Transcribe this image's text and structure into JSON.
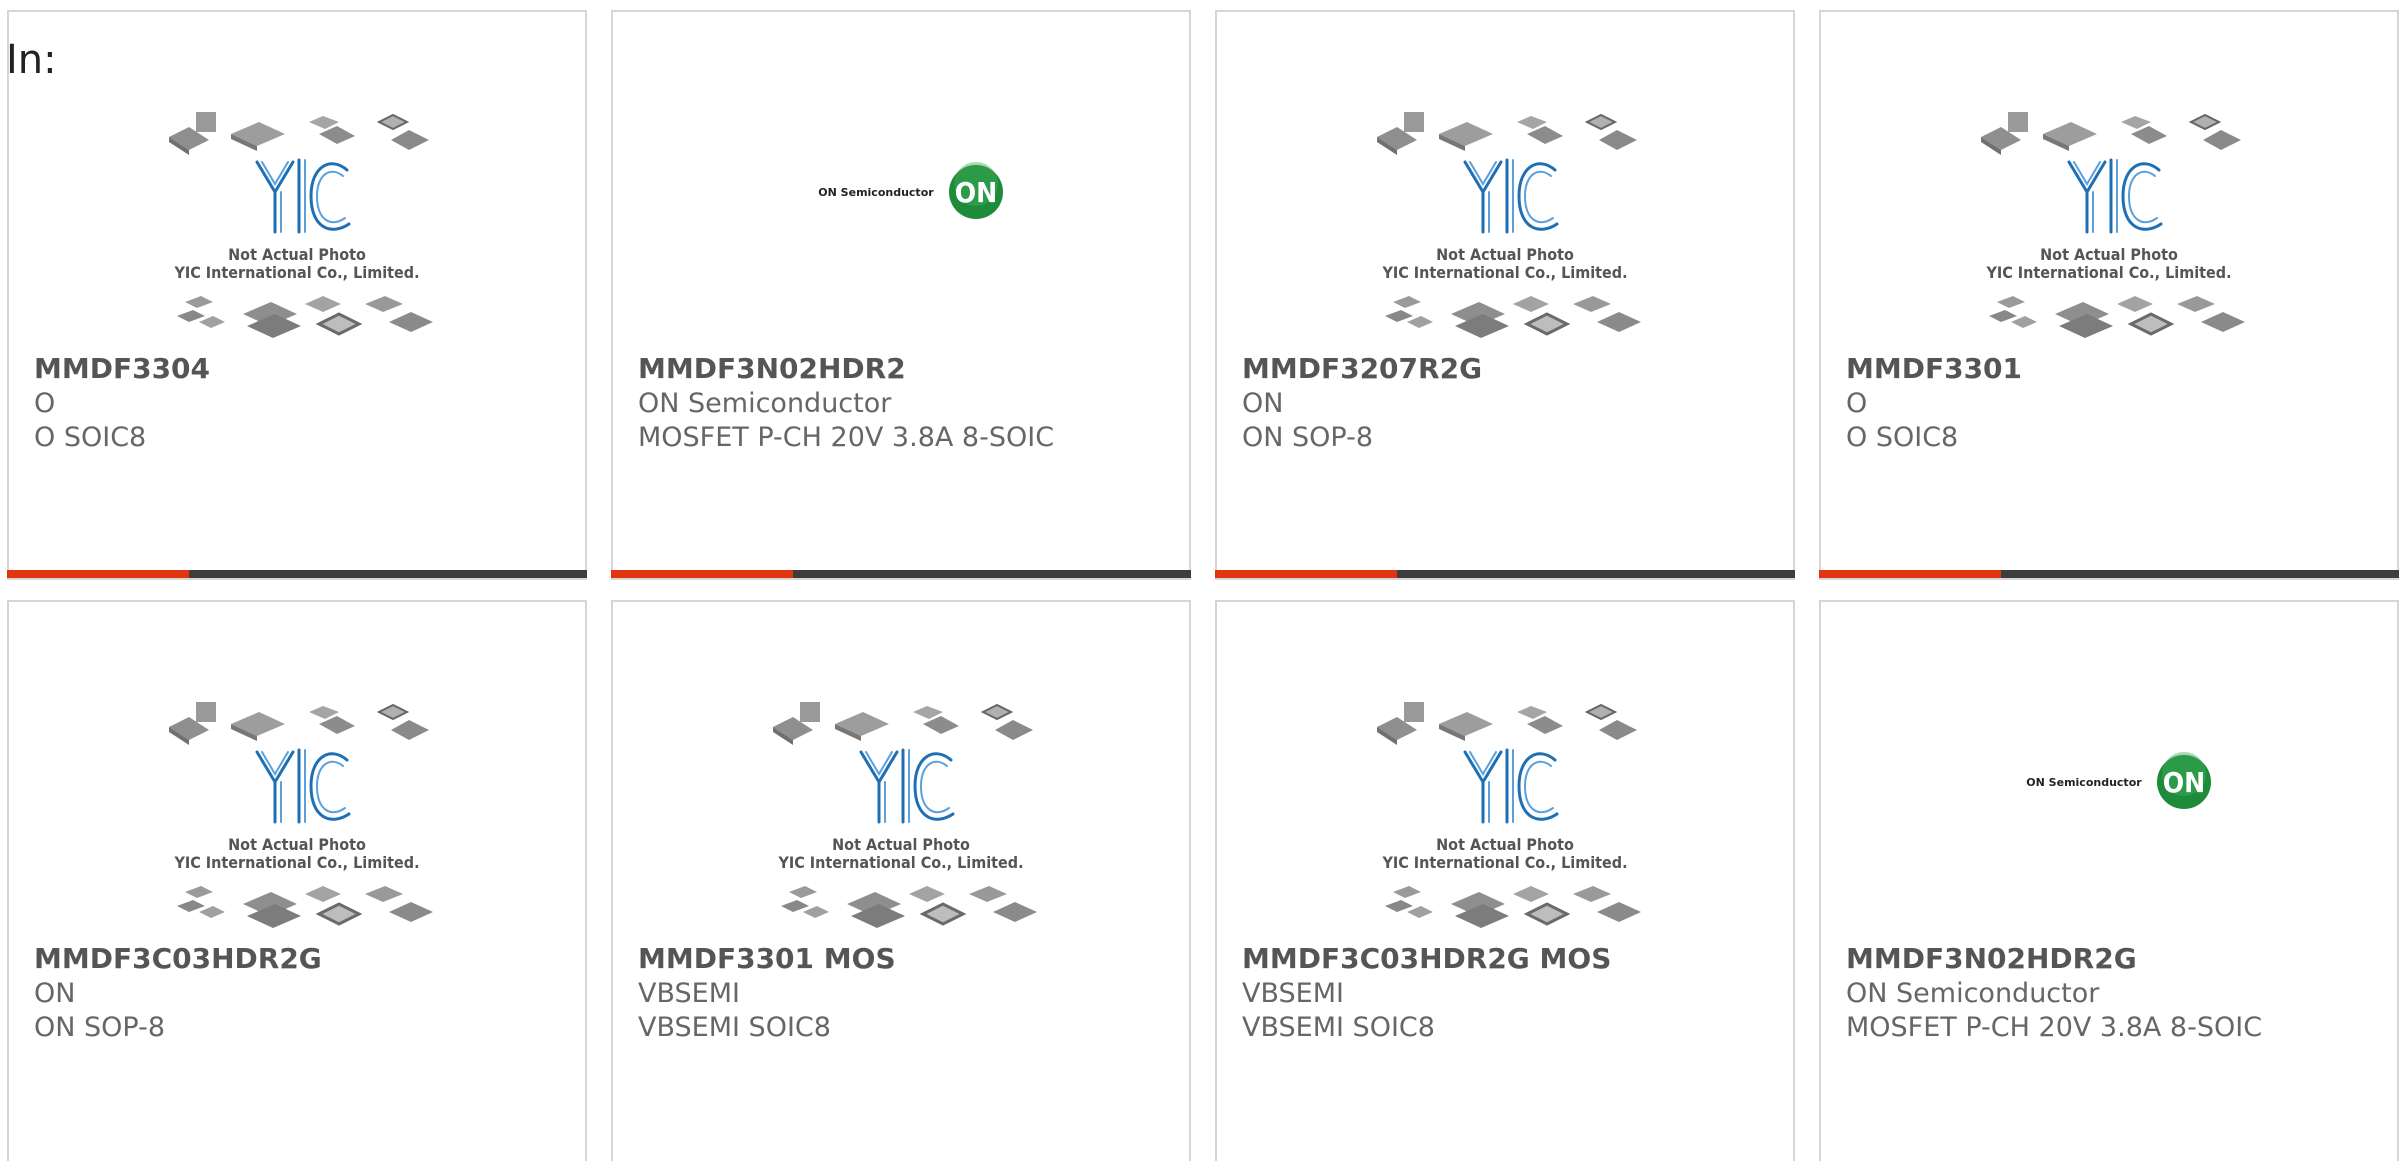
{
  "page": {
    "in_label": "In:"
  },
  "colors": {
    "accent": "#e2340f",
    "bar_dark": "#3d3d3d",
    "on_logo_green": "#1e8b3a",
    "yic_blue": "#1f6fb5"
  },
  "placeholder_image": {
    "line1": "Not Actual Photo",
    "line2": "YIC International Co., Limited.",
    "logo": "YIC"
  },
  "on_logo": {
    "wordmark": "ON Semiconductor",
    "badge": "ON"
  },
  "products": [
    {
      "part_number": "MMDF3304",
      "manufacturer": "O",
      "description": "O SOIC8",
      "image": "yic-placeholder-image"
    },
    {
      "part_number": "MMDF3N02HDR2",
      "manufacturer": "ON Semiconductor",
      "description": "MOSFET P-CH 20V 3.8A 8-SOIC",
      "image": "on-semiconductor-logo"
    },
    {
      "part_number": "MMDF3207R2G",
      "manufacturer": "ON",
      "description": "ON SOP-8",
      "image": "yic-placeholder-image"
    },
    {
      "part_number": "MMDF3301",
      "manufacturer": "O",
      "description": "O SOIC8",
      "image": "yic-placeholder-image"
    },
    {
      "part_number": "MMDF3C03HDR2G",
      "manufacturer": "ON",
      "description": "ON SOP-8",
      "image": "yic-placeholder-image"
    },
    {
      "part_number": "MMDF3301 MOS",
      "manufacturer": "VBSEMI",
      "description": "VBSEMI SOIC8",
      "image": "yic-placeholder-image"
    },
    {
      "part_number": "MMDF3C03HDR2G MOS",
      "manufacturer": "VBSEMI",
      "description": "VBSEMI SOIC8",
      "image": "yic-placeholder-image"
    },
    {
      "part_number": "MMDF3N02HDR2G",
      "manufacturer": "ON Semiconductor",
      "description": "MOSFET P-CH 20V 3.8A 8-SOIC",
      "image": "on-semiconductor-logo"
    }
  ]
}
